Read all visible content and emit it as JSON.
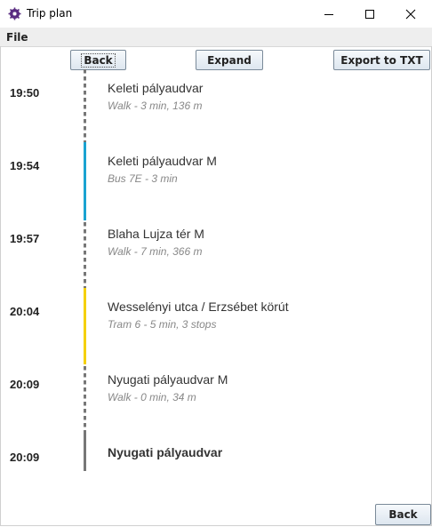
{
  "window": {
    "title": "Trip plan"
  },
  "menu": {
    "file": "File"
  },
  "toolbar": {
    "back": "Back",
    "expand": "Expand",
    "export": "Export to TXT"
  },
  "footer": {
    "back": "Back"
  },
  "colors": {
    "walk": "#777777",
    "bus": "#1aa3d1",
    "tram": "#f5d000",
    "end": "#777777"
  },
  "stops": [
    {
      "time": "19:50",
      "name": "Keleti pályaudvar",
      "detail": "Walk - 3 min, 136 m",
      "mode": "walk"
    },
    {
      "time": "19:54",
      "name": "Keleti pályaudvar M",
      "detail": "Bus 7E - 3 min",
      "mode": "bus"
    },
    {
      "time": "19:57",
      "name": "Blaha Lujza tér M",
      "detail": "Walk - 7 min, 366 m",
      "mode": "walk"
    },
    {
      "time": "20:04",
      "name": "Wesselényi utca / Erzsébet körút",
      "detail": "Tram 6 - 5 min, 3 stops",
      "mode": "tram"
    },
    {
      "time": "20:09",
      "name": "Nyugati pályaudvar M",
      "detail": "Walk - 0 min, 34 m",
      "mode": "walk"
    },
    {
      "time": "20:09",
      "name": "Nyugati pályaudvar",
      "detail": "",
      "mode": "end"
    }
  ]
}
